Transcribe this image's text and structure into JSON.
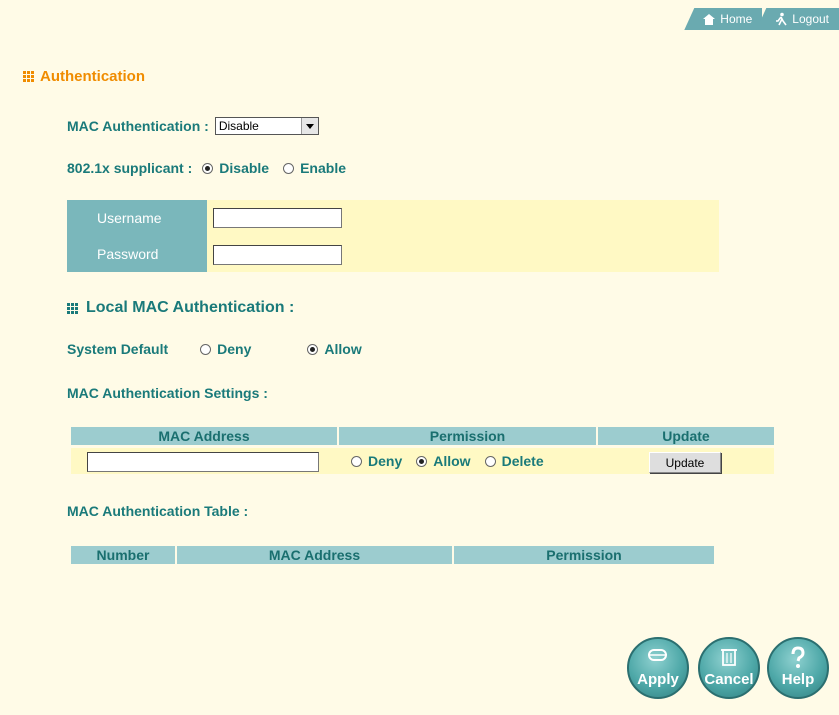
{
  "topnav": {
    "home": "Home",
    "logout": "Logout"
  },
  "section_title": "Authentication",
  "mac_auth": {
    "label": "MAC Authentication :",
    "selected": "Disable"
  },
  "supplicant": {
    "label": "802.1x supplicant :",
    "disable": "Disable",
    "enable": "Enable",
    "selected": "Disable"
  },
  "credentials": {
    "username_label": "Username",
    "password_label": "Password",
    "username_value": "",
    "password_value": ""
  },
  "local_mac": {
    "title": "Local MAC Authentication :"
  },
  "system_default": {
    "label": "System Default",
    "deny": "Deny",
    "allow": "Allow",
    "selected": "Allow"
  },
  "settings": {
    "title": "MAC Authentication Settings :",
    "headers": [
      "MAC Address",
      "Permission",
      "Update"
    ],
    "mac_value": "",
    "perm_deny": "Deny",
    "perm_allow": "Allow",
    "perm_delete": "Delete",
    "perm_selected": "Allow",
    "update_label": "Update"
  },
  "auth_table": {
    "title": "MAC Authentication Table :",
    "headers": [
      "Number",
      "MAC Address",
      "Permission"
    ]
  },
  "actions": {
    "apply": "Apply",
    "cancel": "Cancel",
    "help": "Help"
  },
  "colors": {
    "accent": "#f08c00",
    "teal": "#1a7a7a",
    "header": "#9ccccf",
    "panel": "#fff9c4",
    "background": "#fffbe7"
  }
}
